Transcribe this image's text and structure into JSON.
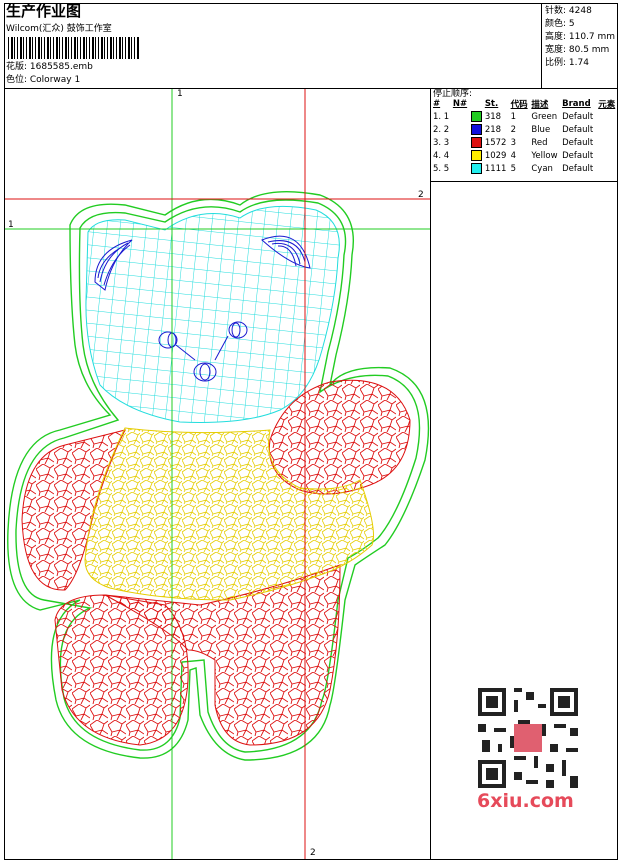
{
  "header": {
    "title": "生产作业图",
    "company": "Wilcom(汇众) 鼓饰工作室",
    "design_label": "花版: 1685585.emb",
    "colorway_label": "色位: Colorway 1"
  },
  "stats": {
    "stitches": "针数: 4248",
    "colors": "颜色: 5",
    "height": "高度: 110.7 mm",
    "width": "宽度: 80.5 mm",
    "scale": "比例: 1.74"
  },
  "stop_sequence": {
    "title": "停止顺序:",
    "columns": [
      "#",
      "N#",
      "St.",
      "代码",
      "描述",
      "Brand",
      "元素"
    ],
    "rows": [
      {
        "idx": "1. 1",
        "color": "#22cc22",
        "st": "318",
        "code": "1",
        "desc": "Green",
        "brand": "Default"
      },
      {
        "idx": "2. 2",
        "color": "#1010dd",
        "st": "218",
        "code": "2",
        "desc": "Blue",
        "brand": "Default"
      },
      {
        "idx": "3. 3",
        "color": "#dd1111",
        "st": "1572",
        "code": "3",
        "desc": "Red",
        "brand": "Default"
      },
      {
        "idx": "4. 4",
        "color": "#ffee00",
        "st": "1029",
        "code": "4",
        "desc": "Yellow",
        "brand": "Default"
      },
      {
        "idx": "5. 5",
        "color": "#22eeee",
        "st": "1111",
        "code": "5",
        "desc": "Cyan",
        "brand": "Default"
      }
    ]
  },
  "guides": {
    "v1": "1",
    "h1": "1",
    "h2": "2",
    "v2": "2"
  },
  "watermark": "6xiu.com",
  "colors": {
    "green": "#22cc22",
    "blue": "#1010dd",
    "red": "#dd1111",
    "yellow": "#ffee00",
    "cyan": "#22eeee"
  }
}
